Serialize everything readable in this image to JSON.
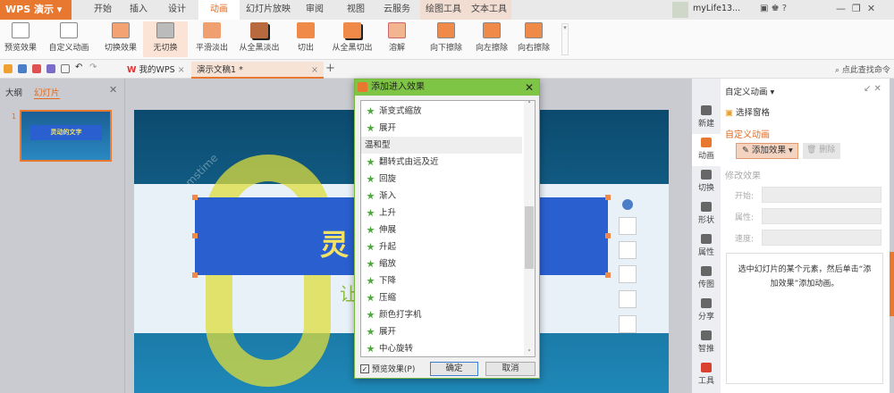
{
  "app": {
    "menu_label": "WPS 演示",
    "user": "myLife13..."
  },
  "tabs": [
    "开始",
    "插入",
    "设计",
    "动画",
    "幻灯片放映",
    "审阅",
    "视图",
    "云服务",
    "绘图工具",
    "文本工具"
  ],
  "ribbon": [
    "预览效果",
    "自定义动画",
    "切换效果",
    "无切换",
    "平滑淡出",
    "从全黑淡出",
    "切出",
    "从全黑切出",
    "溶解",
    "向下擦除",
    "向左擦除",
    "向右擦除"
  ],
  "doc_tabs": {
    "home": "我的WPS",
    "doc": "演示文稿1 *"
  },
  "search_cmd": "点此查找命令",
  "left_panel": {
    "tab_outline": "大纲",
    "tab_slides": "幻灯片",
    "slide_number": "1",
    "thumb_title": "灵动的文字"
  },
  "slide": {
    "title_char": "灵",
    "sub_char": "让",
    "watermark": "dreamstime"
  },
  "iconbar": [
    "新建",
    "动画",
    "切换",
    "形状",
    "属性",
    "传图",
    "分享",
    "智推",
    "工具"
  ],
  "panel": {
    "title": "自定义动画",
    "select_pane": "选择窗格",
    "section": "自定义动画",
    "add_effect": "添加效果",
    "delete": "删除",
    "modify": "修改效果",
    "start": "开始:",
    "property": "属性:",
    "speed": "速度:",
    "hint": "选中幻灯片的某个元素，然后单击“添加效果”添加动画。"
  },
  "dialog": {
    "title": "添加进入效果",
    "items": [
      "渐变式缩放",
      "展开"
    ],
    "group": "温和型",
    "items2": [
      "翻转式由远及近",
      "回旋",
      "渐入",
      "上升",
      "伸展",
      "升起",
      "缩放",
      "下降",
      "压缩",
      "颜色打字机",
      "展开",
      "中心旋转"
    ],
    "preview_label": "预览效果(P)",
    "preview_checked": true,
    "ok": "确定",
    "cancel": "取消"
  }
}
